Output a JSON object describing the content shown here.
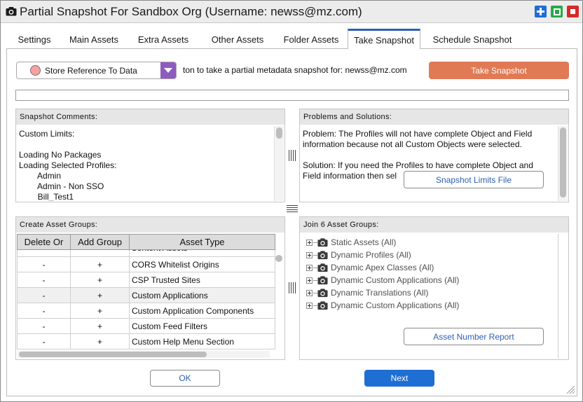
{
  "window": {
    "title": "Partial Snapshot For Sandbox Org (Username: newss@mz.com)",
    "title_icon": "camera-icon",
    "controls": [
      "maximize-plus-icon",
      "restore-square-icon",
      "close-square-icon"
    ]
  },
  "tabs": [
    {
      "label": "Settings"
    },
    {
      "label": "Main Assets"
    },
    {
      "label": "Extra Assets"
    },
    {
      "label": "Other Assets"
    },
    {
      "label": "Folder Assets"
    },
    {
      "label": "Take Snapshot",
      "active": true
    },
    {
      "label": "Schedule Snapshot"
    }
  ],
  "toolbar": {
    "dropdown_selected": "Store Reference To Data",
    "instruction": "ton to take a partial metadata snapshot for: newss@mz.com",
    "take_snapshot_label": "Take Snapshot",
    "progress": 0
  },
  "comments": {
    "header": "Snapshot Comments:",
    "lines": [
      "Custom Limits:",
      "",
      "Loading No Packages",
      "Loading Selected Profiles:",
      "        Admin",
      "        Admin - Non SSO",
      "        Bill_Test1"
    ]
  },
  "problems": {
    "header": "Problems and Solutions:",
    "lines": [
      "Problem: The Profiles will not have complete Object and Field",
      "information because not all Custom Objects were selected.",
      "",
      "Solution: If you need the Profiles to have complete Object and",
      "Field information then sel"
    ],
    "limits_button": "Snapshot Limits File"
  },
  "asset_groups": {
    "header": "Create Asset Groups:",
    "columns": [
      "Delete Or",
      "Add Group",
      "Asset Type"
    ],
    "partial_row": {
      "delete": "-",
      "add": "+",
      "type": "Content Assets"
    },
    "rows": [
      {
        "delete": "-",
        "add": "+",
        "type": "CORS Whitelist Origins"
      },
      {
        "delete": "-",
        "add": "+",
        "type": "CSP Trusted Sites"
      },
      {
        "delete": "-",
        "add": "+",
        "type": "Custom Applications"
      },
      {
        "delete": "-",
        "add": "+",
        "type": "Custom Application Components"
      },
      {
        "delete": "-",
        "add": "+",
        "type": "Custom Feed Filters"
      },
      {
        "delete": "-",
        "add": "+",
        "type": "Custom Help Menu Section"
      }
    ]
  },
  "join": {
    "header": "Join 6 Asset Groups:",
    "items": [
      "Static Assets (All)",
      "Dynamic Profiles (All)",
      "Dynamic Apex Classes (All)",
      "Dynamic Custom Applications (All)",
      "Dynamic Translations (All)",
      "Dynamic Custom Applications (All)"
    ],
    "report_button": "Asset Number Report"
  },
  "footer": {
    "ok_label": "OK",
    "next_label": "Next"
  },
  "colors": {
    "accent_blue": "#1f6ed4",
    "take_snapshot_orange": "#e07a55",
    "dropdown_purple": "#8e5bbf",
    "tab_highlight": "#2e5fb3"
  }
}
